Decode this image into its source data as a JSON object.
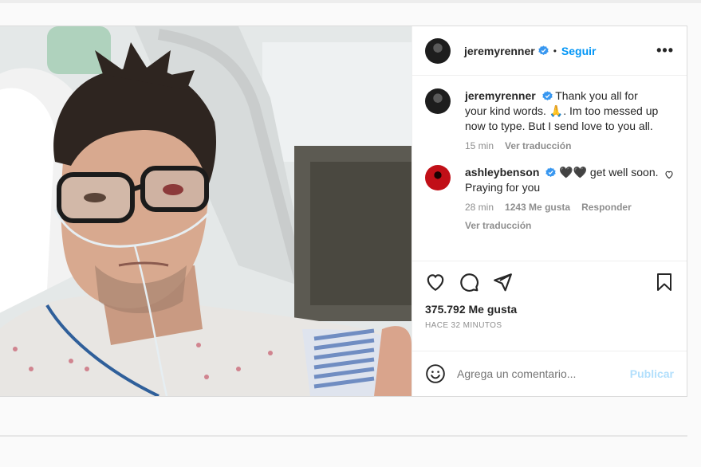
{
  "post": {
    "username": "jeremyrenner",
    "follow_label": "Seguir",
    "separator": "•",
    "more_label": "•••",
    "caption": {
      "username": "jeremyrenner",
      "text": "Thank you all for your kind words. 🙏. Im too messed up now to type. But I send love to you all.",
      "time": "15 min",
      "translate_label": "Ver traducción"
    },
    "comments": [
      {
        "username": "ashleybenson",
        "text": "🖤🖤 get well soon. Praying for you",
        "time": "28 min",
        "likes": "1243 Me gusta",
        "reply_label": "Responder",
        "translate_label": "Ver traducción"
      }
    ],
    "likes_text": "375.792 Me gusta",
    "timestamp": "HACE 32 MINUTOS",
    "comment_placeholder": "Agrega un comentario...",
    "publish_label": "Publicar"
  },
  "icons": {
    "like": "heart-icon",
    "comment": "comment-bubble-icon",
    "share": "paper-plane-icon",
    "save": "bookmark-icon",
    "emoji": "smiley-icon",
    "verified": "verified-badge-icon"
  },
  "colors": {
    "link_blue": "#0095f6",
    "verified_blue": "#3897f0",
    "publish_disabled": "#b2dffc",
    "muted": "#8e8e8e"
  }
}
